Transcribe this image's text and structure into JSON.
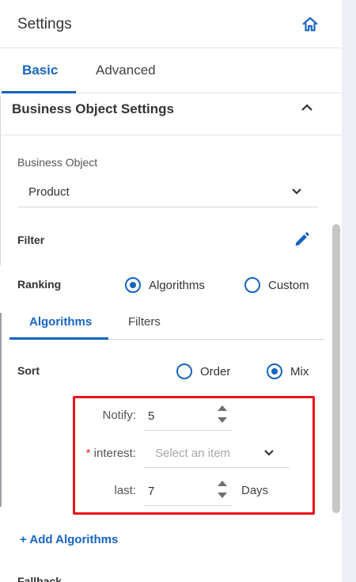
{
  "header": {
    "title": "Settings",
    "home_icon": "home-icon"
  },
  "tabs": [
    {
      "label": "Basic",
      "active": true
    },
    {
      "label": "Advanced",
      "active": false
    }
  ],
  "section": {
    "title": "Business Object Settings",
    "toggle_icon": "chevron-up-icon"
  },
  "business_object": {
    "label": "Business Object",
    "value": "Product"
  },
  "filter": {
    "label": "Filter",
    "edit_icon": "pencil-icon"
  },
  "ranking": {
    "label": "Ranking",
    "options": [
      {
        "label": "Algorithms",
        "selected": true
      },
      {
        "label": "Custom",
        "selected": false
      }
    ]
  },
  "subtabs": [
    {
      "label": "Algorithms",
      "active": true
    },
    {
      "label": "Filters",
      "active": false
    }
  ],
  "sort": {
    "label": "Sort",
    "options": [
      {
        "label": "Order",
        "selected": false
      },
      {
        "label": "Mix",
        "selected": true
      }
    ]
  },
  "mix": {
    "notify": {
      "label": "Notify:",
      "value": "5"
    },
    "interest": {
      "required_mark": "*",
      "label": "interest:",
      "placeholder": "Select an item"
    },
    "last": {
      "label": "last:",
      "value": "7",
      "unit": "Days"
    }
  },
  "add_algorithms": "+ Add Algorithms",
  "fallback": {
    "label": "Fallback"
  },
  "colors": {
    "accent": "#1764c0",
    "highlight_box": "#e8141b"
  }
}
